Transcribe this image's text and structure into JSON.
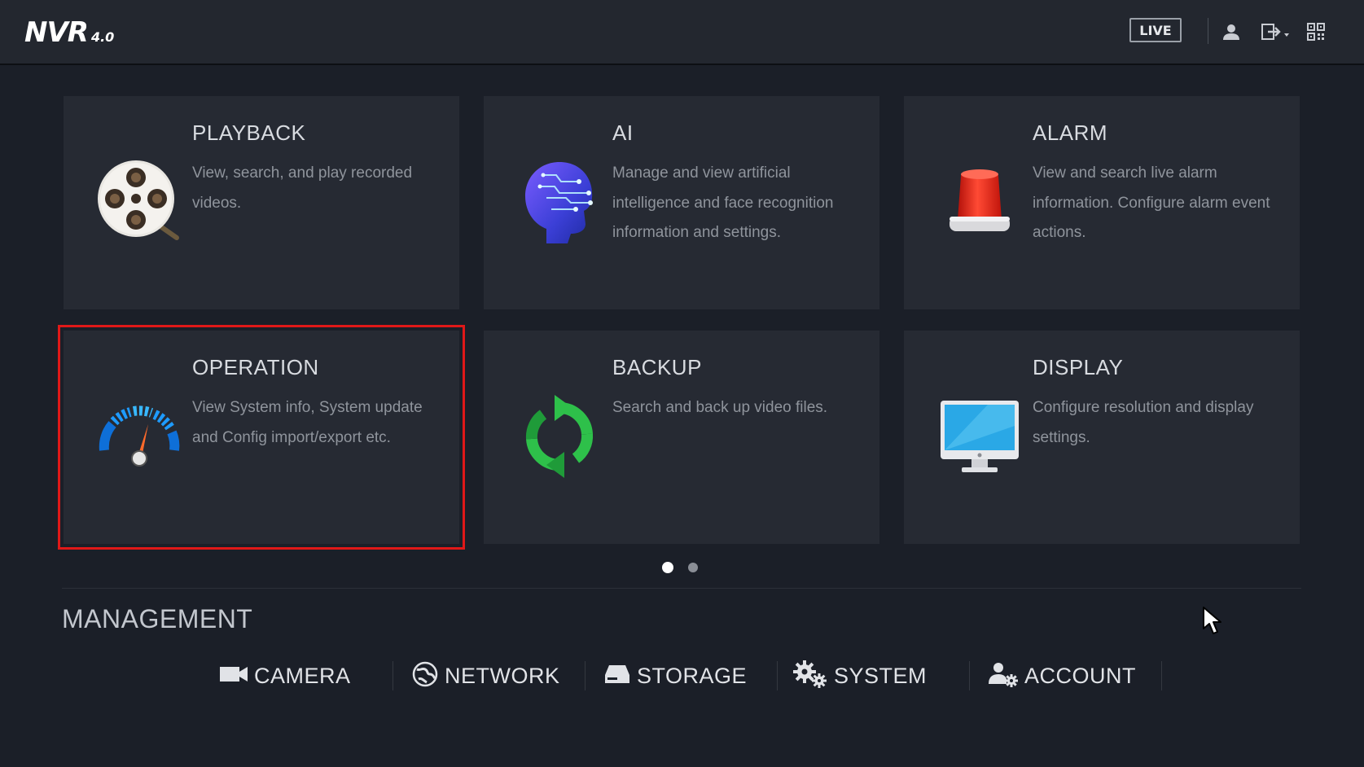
{
  "header": {
    "logo_main": "NVR",
    "logo_version": "4.0",
    "live_label": "LIVE",
    "icons": [
      "user-icon",
      "logout-icon",
      "qr-code-icon"
    ]
  },
  "cards": [
    {
      "title": "PLAYBACK",
      "desc": "View, search, and play recorded videos.",
      "icon": "film-reel-icon"
    },
    {
      "title": "AI",
      "desc": "Manage and view artificial intelligence and face recognition information and settings.",
      "icon": "ai-head-icon"
    },
    {
      "title": "ALARM",
      "desc": "View and search live alarm information. Configure alarm event actions.",
      "icon": "alarm-siren-icon"
    },
    {
      "title": "OPERATION",
      "desc": "View System info, System update and Config import/export etc.",
      "icon": "gauge-icon",
      "selected": true
    },
    {
      "title": "BACKUP",
      "desc": "Search and back up video files.",
      "icon": "refresh-icon"
    },
    {
      "title": "DISPLAY",
      "desc": "Configure resolution and display settings.",
      "icon": "monitor-icon"
    }
  ],
  "pagination": {
    "total": 2,
    "active": 1
  },
  "management": {
    "title": "MANAGEMENT",
    "items": [
      {
        "label": "CAMERA",
        "icon": "camera-icon"
      },
      {
        "label": "NETWORK",
        "icon": "network-globe-icon"
      },
      {
        "label": "STORAGE",
        "icon": "storage-drive-icon"
      },
      {
        "label": "SYSTEM",
        "icon": "gears-icon"
      },
      {
        "label": "ACCOUNT",
        "icon": "account-settings-icon"
      }
    ]
  },
  "colors": {
    "background": "#1b1f28",
    "card": "#262a33",
    "selection": "#e01818",
    "gauge": "#1e9bff",
    "backup_arrows": "#2ec04a",
    "alarm": "#e52a1c",
    "monitor_screen": "#2aa8e6"
  }
}
